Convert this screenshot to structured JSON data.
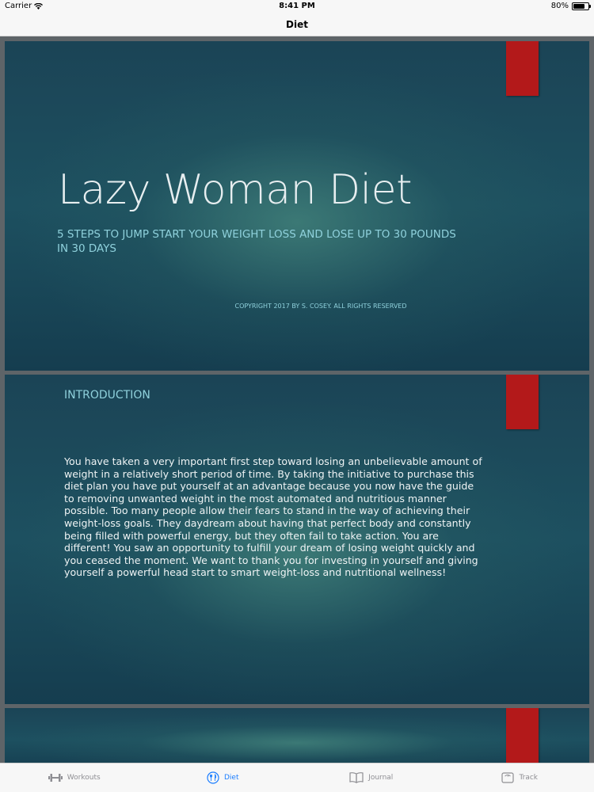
{
  "status": {
    "carrier": "Carrier",
    "time": "8:41 PM",
    "battery": "80%"
  },
  "nav": {
    "title": "Diet"
  },
  "slides": [
    {
      "title": "Lazy Woman Diet",
      "subtitle": "5 steps to jump start your weight loss and lose up to 30 pounds in 30 days",
      "copyright": "Copyright 2017 by S. Cosey. All rights reserved"
    },
    {
      "heading": "Introduction",
      "body": "You have taken a very important first step toward losing an unbelievable amount of weight in a relatively short period of time. By taking the initiative to purchase this diet plan you have put yourself at an advantage because you now have the guide to removing unwanted weight in the most automated and nutritious manner possible. Too many people allow their fears to stand in the way of achieving their weight-loss goals. They daydream about having that perfect body and constantly being filled with powerful energy, but they often fail to take action. You are different! You saw an opportunity to fulfill your dream of losing weight quickly and you ceased the moment. We want to thank you for investing in yourself and giving yourself a powerful head start to smart weight-loss and nutritional wellness!"
    }
  ],
  "tabs": [
    {
      "label": "Workouts",
      "icon": "dumbbell-icon",
      "active": false
    },
    {
      "label": "Diet",
      "icon": "diet-icon",
      "active": true
    },
    {
      "label": "Journal",
      "icon": "book-icon",
      "active": false
    },
    {
      "label": "Track",
      "icon": "scale-icon",
      "active": false
    }
  ],
  "colors": {
    "accent": "#1a7dff",
    "slide_red_tab": "#b3191a",
    "slide_text_accent": "#8fd1dc"
  }
}
